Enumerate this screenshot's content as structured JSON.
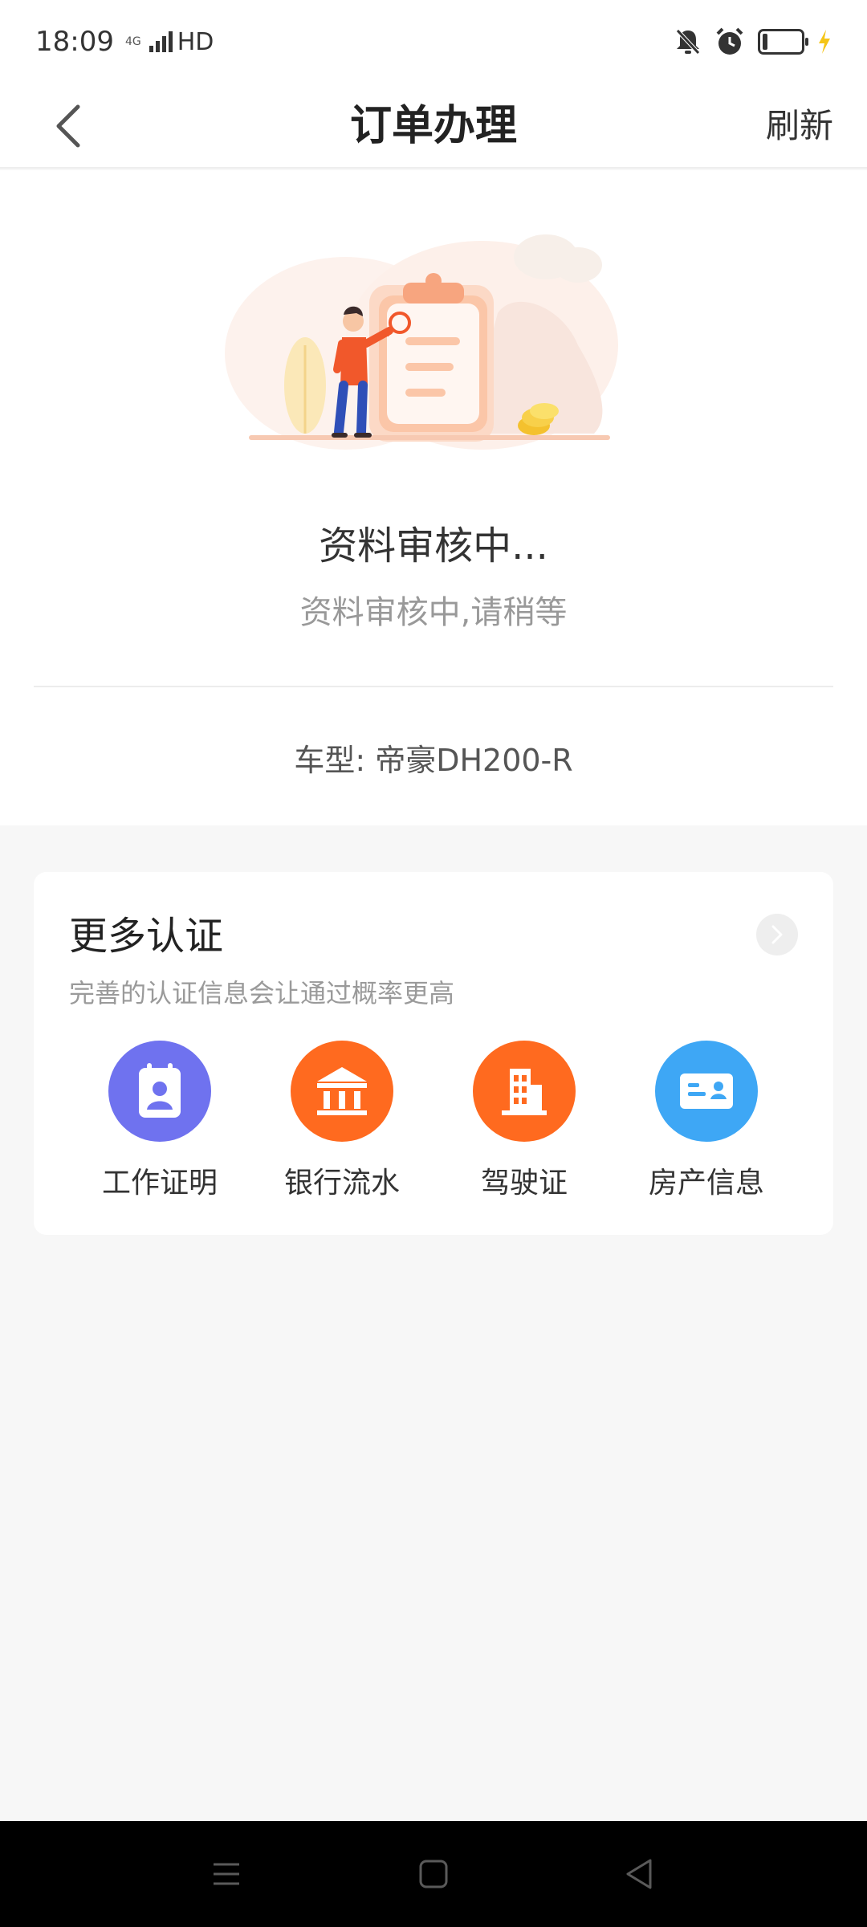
{
  "status_bar": {
    "time": "18:09",
    "network_small": "4G",
    "network_label": "HD"
  },
  "header": {
    "title": "订单办理",
    "refresh_label": "刷新"
  },
  "order_status": {
    "title": "资料审核中...",
    "subtitle": "资料审核中,请稍等",
    "model_text": "车型: 帝豪DH200-R"
  },
  "more_auth": {
    "title": "更多认证",
    "subtitle": "完善的认证信息会让通过概率更高",
    "items": [
      {
        "label": "工作证明",
        "icon": "id-badge-icon",
        "color": "#6f72ef"
      },
      {
        "label": "银行流水",
        "icon": "bank-icon",
        "color": "#ff6a1f"
      },
      {
        "label": "驾驶证",
        "icon": "building-icon",
        "color": "#ff6a1f"
      },
      {
        "label": "房产信息",
        "icon": "id-card-icon",
        "color": "#3ea7f5"
      }
    ]
  },
  "nav_bar": {
    "buttons": [
      "menu",
      "home",
      "back"
    ]
  }
}
